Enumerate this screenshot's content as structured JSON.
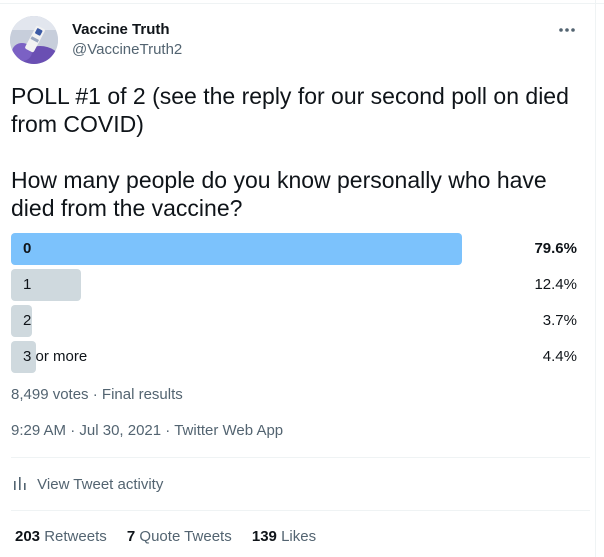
{
  "author": {
    "display_name": "Vaccine Truth",
    "handle": "@VaccineTruth2"
  },
  "tweet": {
    "line1": "POLL #1 of 2 (see the reply for our second poll on died from COVID)",
    "line2": "How many people do you know personally who have died from the vaccine?"
  },
  "poll": {
    "options": [
      {
        "label": "0",
        "percent": "79.6%",
        "share": 0.796,
        "winner": true
      },
      {
        "label": "1",
        "percent": "12.4%",
        "share": 0.124,
        "winner": false
      },
      {
        "label": "2",
        "percent": "3.7%",
        "share": 0.037,
        "winner": false
      },
      {
        "label": "3 or more",
        "percent": "4.4%",
        "share": 0.044,
        "winner": false
      }
    ],
    "votes": "8,499 votes",
    "separator": "·",
    "status": "Final results"
  },
  "meta": {
    "time": "9:29 AM",
    "date": "Jul 30, 2021",
    "separator": "·",
    "source": "Twitter Web App"
  },
  "activity_label": "View Tweet activity",
  "stats": {
    "retweets_count": "203",
    "retweets_label": "Retweets",
    "quotes_count": "7",
    "quotes_label": "Quote Tweets",
    "likes_count": "139",
    "likes_label": "Likes"
  },
  "colors": {
    "winner_bar": "#7cc2fc",
    "other_bar": "#cfd9de",
    "secondary_text": "#536471"
  },
  "icons": {
    "more": "more-dots-icon",
    "activity": "bar-chart-icon"
  }
}
